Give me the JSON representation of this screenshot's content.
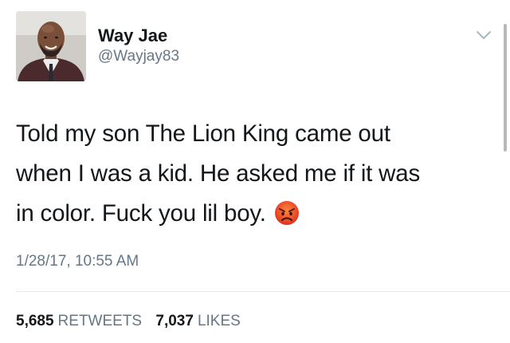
{
  "user": {
    "display_name": "Way Jae",
    "handle": "@Wayjay83",
    "avatar_icon": "profile-photo"
  },
  "menu_icon": "chevron-down-icon",
  "tweet": {
    "line1": "Told my son The Lion King came out",
    "line2": "when I was a kid.  He asked me if it was",
    "line3": "in color.  Fuck you lil boy.",
    "emoji": "angry-face-emoji"
  },
  "timestamp": "1/28/17, 10:55 AM",
  "stats": {
    "retweets_count": "5,685",
    "retweets_label": "RETWEETS",
    "likes_count": "7,037",
    "likes_label": "LIKES"
  },
  "colors": {
    "text": "#14171a",
    "secondary": "#657786",
    "divider": "#e1e8ed"
  }
}
